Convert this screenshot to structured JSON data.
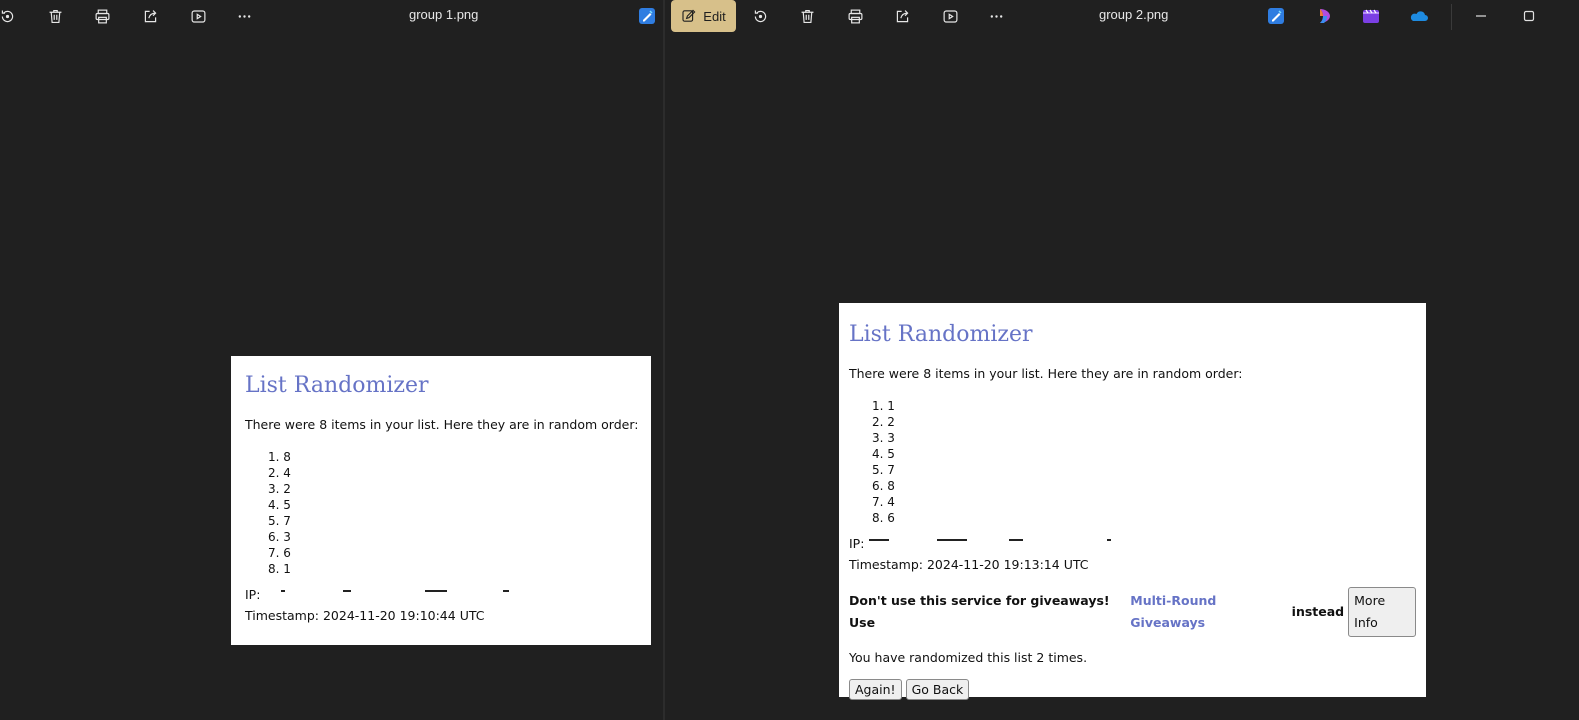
{
  "left_viewer": {
    "filename": "group 1.png",
    "photo": {
      "title": "List Randomizer",
      "intro": "There were 8 items in your list. Here they are in random order:",
      "items": [
        "1. 8",
        "2. 4",
        "3. 2",
        "4. 5",
        "5. 7",
        "6. 3",
        "7. 6",
        "8. 1"
      ],
      "ip_label": "IP:",
      "timestamp": "Timestamp: 2024-11-20 19:10:44 UTC"
    }
  },
  "right_viewer": {
    "filename": "group 2.png",
    "edit_label": "Edit",
    "photo": {
      "title": "List Randomizer",
      "intro": "There were 8 items in your list. Here they are in random order:",
      "items": [
        "1. 1",
        "2. 2",
        "3. 3",
        "4. 5",
        "5. 7",
        "6. 8",
        "7. 4",
        "8. 6"
      ],
      "ip_label": "IP:",
      "timestamp": "Timestamp: 2024-11-20 19:13:14 UTC",
      "warning_prefix": "Don't use this service for giveaways! Use",
      "warning_link": "Multi-Round Giveaways",
      "warning_suffix": "instead",
      "more_info_label": "More Info",
      "count_text": "You have randomized this list 2 times.",
      "again_label": "Again!",
      "go_back_label": "Go Back"
    }
  },
  "colors": {
    "app_bg": "#202020",
    "edit_accent": "#d7c08a",
    "doc_title": "#6673c6",
    "link": "#6673c6"
  },
  "icons": {
    "toolbar": [
      "rotate-icon",
      "delete-icon",
      "print-icon",
      "share-icon",
      "slideshow-icon",
      "more-icon",
      "designer-icon"
    ],
    "apps": [
      "designer-icon",
      "copilot-icon",
      "clipchamp-icon",
      "onedrive-icon"
    ],
    "window": [
      "minimize-icon",
      "maximize-icon"
    ]
  }
}
